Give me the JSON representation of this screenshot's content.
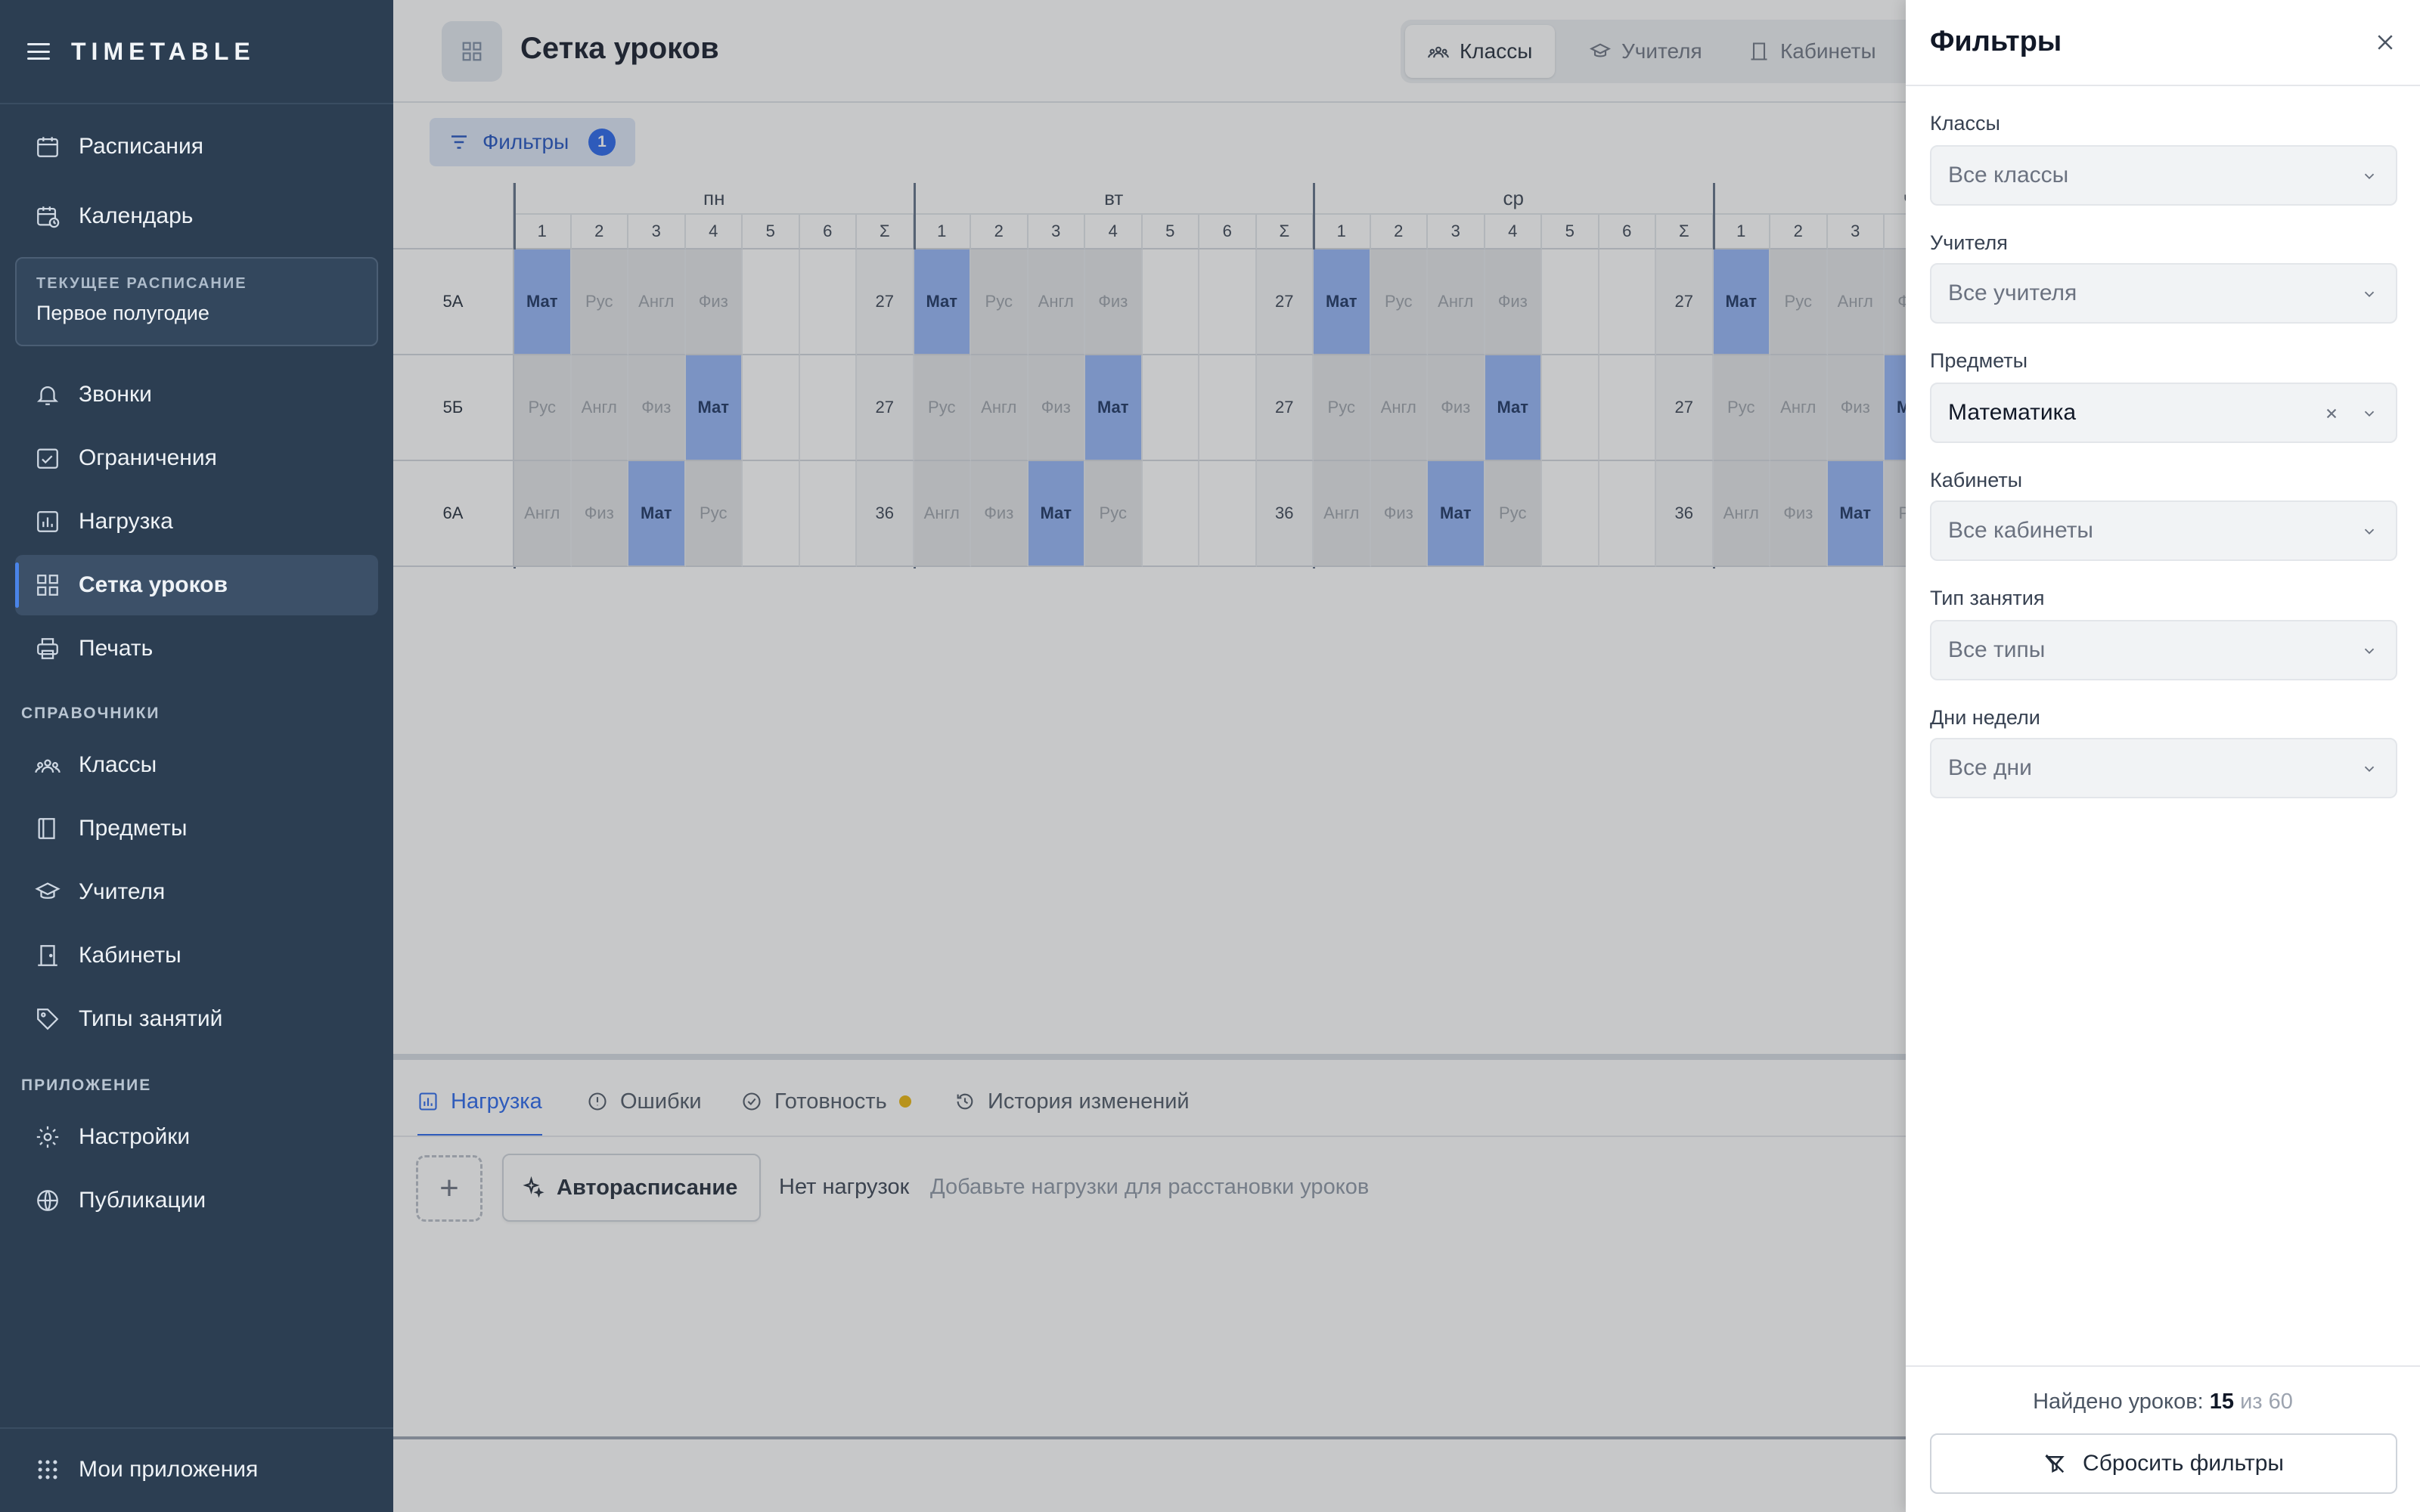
{
  "sidebar": {
    "brand": "TIMETABLE",
    "items_top": [
      {
        "label": "Расписания",
        "icon": "calendar-icon"
      },
      {
        "label": "Календарь",
        "icon": "calendar-clock-icon"
      }
    ],
    "current": {
      "label": "ТЕКУЩЕЕ РАСПИСАНИЕ",
      "value": "Первое полугодие"
    },
    "items_mid": [
      {
        "label": "Звонки",
        "icon": "bell-icon"
      },
      {
        "label": "Ограничения",
        "icon": "calendar-check-icon"
      },
      {
        "label": "Нагрузка",
        "icon": "bar-chart-icon"
      },
      {
        "label": "Сетка уроков",
        "icon": "grid-icon",
        "active": true
      },
      {
        "label": "Печать",
        "icon": "printer-icon"
      }
    ],
    "section_ref": "СПРАВОЧНИКИ",
    "items_ref": [
      {
        "label": "Классы",
        "icon": "users-icon"
      },
      {
        "label": "Предметы",
        "icon": "book-icon"
      },
      {
        "label": "Учителя",
        "icon": "graduation-cap-icon"
      },
      {
        "label": "Кабинеты",
        "icon": "door-icon"
      },
      {
        "label": "Типы занятий",
        "icon": "tag-icon"
      }
    ],
    "section_app": "ПРИЛОЖЕНИЕ",
    "items_app": [
      {
        "label": "Настройки",
        "icon": "gear-icon"
      },
      {
        "label": "Публикации",
        "icon": "globe-icon"
      }
    ],
    "footer": {
      "label": "Мои приложения",
      "icon": "apps-grid-icon"
    }
  },
  "header": {
    "title": "Сетка уроков",
    "views": [
      {
        "label": "Классы",
        "active": true
      },
      {
        "label": "Учителя"
      },
      {
        "label": "Кабинеты"
      }
    ]
  },
  "filter_button": {
    "label": "Фильтры",
    "count": "1"
  },
  "grid": {
    "days": [
      "пн",
      "вт",
      "ср",
      "чт"
    ],
    "periods": [
      "1",
      "2",
      "3",
      "4",
      "5",
      "6",
      "Σ"
    ],
    "classes": [
      {
        "name": "5А",
        "lessons": [
          "Мат",
          "Рус",
          "Англ",
          "Физ"
        ],
        "total": "27"
      },
      {
        "name": "5Б",
        "lessons": [
          "Рус",
          "Англ",
          "Физ",
          "Мат"
        ],
        "total": "27"
      },
      {
        "name": "6А",
        "lessons": [
          "Англ",
          "Физ",
          "Мат",
          "Рус"
        ],
        "total": "36"
      }
    ],
    "highlight_subject": "Мат"
  },
  "bottom": {
    "tabs": [
      {
        "label": "Нагрузка",
        "icon": "bar-chart-icon",
        "active": true
      },
      {
        "label": "Ошибки",
        "icon": "alert-circle-icon"
      },
      {
        "label": "Готовность",
        "icon": "check-badge-icon",
        "dot_color": "#eab308"
      },
      {
        "label": "История изменений",
        "icon": "history-icon"
      }
    ],
    "add_label": "+",
    "autoschedule_label": "Авторасписание",
    "no_loads_title": "Нет нагрузок",
    "no_loads_hint": "Добавьте нагрузки для расстановки уроков"
  },
  "drawer": {
    "title": "Фильтры",
    "fields": [
      {
        "label": "Классы",
        "value": "Все классы"
      },
      {
        "label": "Учителя",
        "value": "Все учителя"
      },
      {
        "label": "Предметы",
        "value": "Математика",
        "filled": true
      },
      {
        "label": "Кабинеты",
        "value": "Все кабинеты"
      },
      {
        "label": "Тип занятия",
        "value": "Все типы"
      },
      {
        "label": "Дни недели",
        "value": "Все дни"
      }
    ],
    "found_prefix": "Найдено уроков:",
    "found_count": "15",
    "found_of": "из 60",
    "reset_label": "Сбросить фильтры"
  },
  "colors": {
    "sidebar_bg": "#2c3e52",
    "accent": "#2563eb",
    "lesson_highlight": "#93b4f7",
    "status_dot": "#eab308"
  }
}
